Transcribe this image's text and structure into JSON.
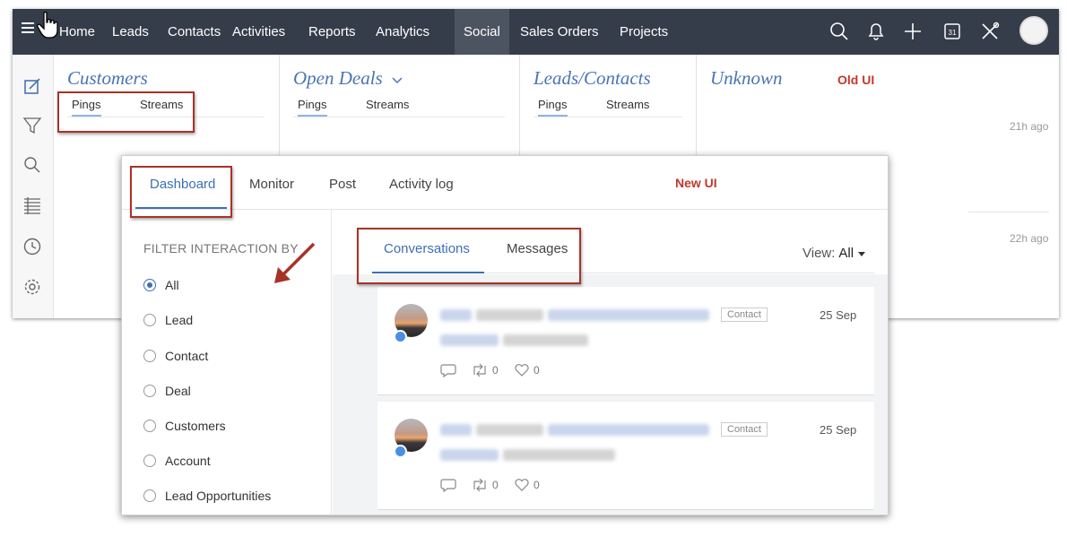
{
  "old_ui": {
    "nav": {
      "tabs": [
        {
          "label": "Home"
        },
        {
          "label": "Leads"
        },
        {
          "label": "Contacts"
        },
        {
          "label": "Activities"
        },
        {
          "label": "Reports"
        },
        {
          "label": "Analytics"
        },
        {
          "label": "Social"
        },
        {
          "label": "Sales Orders"
        },
        {
          "label": "Projects"
        }
      ],
      "active_tab": "Social",
      "icons": [
        "search-icon",
        "bell-icon",
        "plus-icon",
        "calendar-icon",
        "tools-icon",
        "avatar"
      ],
      "calendar_day": "31"
    },
    "rail_icons": [
      "compose-icon",
      "filter-icon",
      "search-icon",
      "list-icon",
      "clock-icon",
      "gear-icon"
    ],
    "columns": [
      {
        "title": "Customers",
        "tabs": [
          "Pings",
          "Streams"
        ]
      },
      {
        "title": "Open Deals",
        "tabs": [
          "Pings",
          "Streams"
        ]
      },
      {
        "title": "Leads/Contacts",
        "tabs": [
          "Pings",
          "Streams"
        ]
      },
      {
        "title": "Unknown",
        "tabs": []
      }
    ],
    "annotation_label": "Old UI",
    "times": [
      "21h ago",
      "22h ago"
    ]
  },
  "new_ui": {
    "annotation_label": "New UI",
    "tabs": [
      {
        "label": "Dashboard"
      },
      {
        "label": "Monitor"
      },
      {
        "label": "Post"
      },
      {
        "label": "Activity log"
      }
    ],
    "active_tab": "Dashboard",
    "filter": {
      "heading": "FILTER INTERACTION BY",
      "options": [
        "All",
        "Lead",
        "Contact",
        "Deal",
        "Customers",
        "Account",
        "Lead Opportunities"
      ],
      "selected": "All"
    },
    "feed": {
      "tabs": [
        "Conversations",
        "Messages"
      ],
      "active_tab": "Conversations",
      "view_label": "View:",
      "view_value": "All",
      "cards": [
        {
          "tag": "Contact",
          "date": "25 Sep",
          "replies": "",
          "retweets": "0",
          "likes": "0"
        },
        {
          "tag": "Contact",
          "date": "25 Sep",
          "replies": "",
          "retweets": "0",
          "likes": "0"
        }
      ]
    }
  },
  "colors": {
    "nav_bg": "#353d4a",
    "accent": "#3d6fb6",
    "annotation_red": "#c0392b",
    "highlight_box": "#a93226"
  }
}
